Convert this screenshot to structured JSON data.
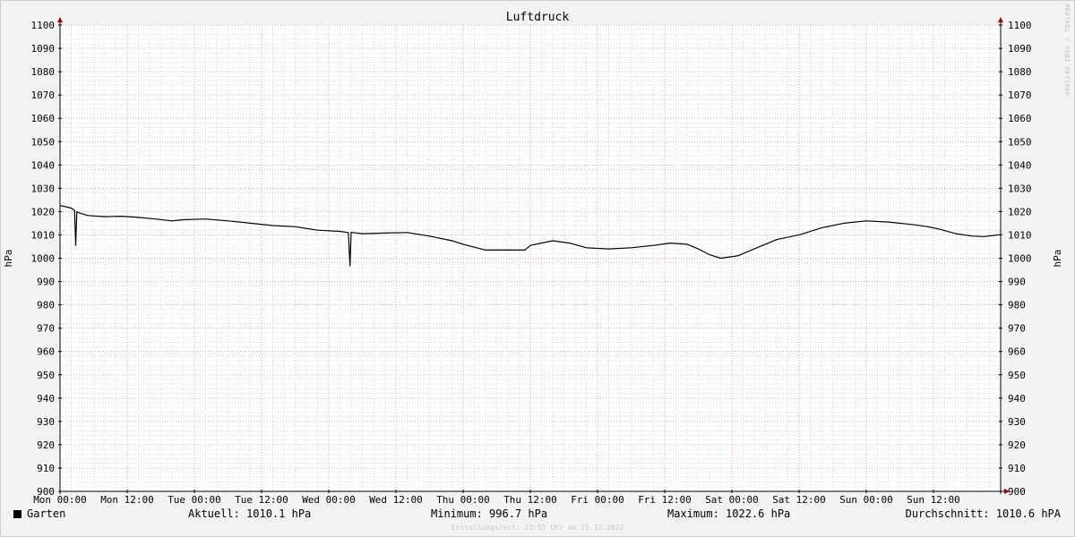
{
  "chart_data": {
    "type": "line",
    "title": "Luftdruck",
    "ylabel": "hPa",
    "ylim": [
      900,
      1100
    ],
    "yticks": [
      900,
      910,
      920,
      930,
      940,
      950,
      960,
      970,
      980,
      990,
      1000,
      1010,
      1020,
      1030,
      1040,
      1050,
      1060,
      1070,
      1080,
      1090,
      1100
    ],
    "xlim": [
      0,
      168
    ],
    "x_unit": "hours since Mon 00:00",
    "xticks": [
      {
        "x": 0,
        "label": "Mon 00:00"
      },
      {
        "x": 12,
        "label": "Mon 12:00"
      },
      {
        "x": 24,
        "label": "Tue 00:00"
      },
      {
        "x": 36,
        "label": "Tue 12:00"
      },
      {
        "x": 48,
        "label": "Wed 00:00"
      },
      {
        "x": 60,
        "label": "Wed 12:00"
      },
      {
        "x": 72,
        "label": "Thu 00:00"
      },
      {
        "x": 84,
        "label": "Thu 12:00"
      },
      {
        "x": 96,
        "label": "Fri 00:00"
      },
      {
        "x": 108,
        "label": "Fri 12:00"
      },
      {
        "x": 120,
        "label": "Sat 00:00"
      },
      {
        "x": 132,
        "label": "Sat 12:00"
      },
      {
        "x": 144,
        "label": "Sun 00:00"
      },
      {
        "x": 156,
        "label": "Sun 12:00"
      }
    ],
    "grid": true,
    "series": [
      {
        "name": "Garten",
        "color": "#000000",
        "x": [
          0,
          2,
          2.6,
          2.8,
          3.0,
          3.3,
          5,
          8,
          11,
          14,
          17,
          20,
          22,
          26,
          30,
          34,
          38,
          42,
          46,
          50,
          51.5,
          51.8,
          52.0,
          52.3,
          54,
          58,
          62,
          66,
          70,
          72,
          76,
          80,
          83,
          84,
          88,
          91,
          94,
          98,
          102,
          106,
          109,
          112,
          114,
          116,
          118,
          121,
          124,
          128,
          132,
          136,
          140,
          144,
          148,
          152,
          155,
          157,
          160,
          163,
          165,
          168
        ],
        "y": [
          1022.6,
          1021.5,
          1020.5,
          1005.5,
          1020.0,
          1019.5,
          1018.3,
          1017.8,
          1018.0,
          1017.5,
          1016.8,
          1016.0,
          1016.5,
          1016.8,
          1016.0,
          1015.0,
          1014.0,
          1013.5,
          1012.0,
          1011.5,
          1011.0,
          996.7,
          1011.2,
          1011.0,
          1010.5,
          1010.8,
          1011.0,
          1009.5,
          1007.5,
          1006.0,
          1003.5,
          1003.5,
          1003.5,
          1005.5,
          1007.5,
          1006.5,
          1004.5,
          1004.0,
          1004.5,
          1005.5,
          1006.5,
          1006.0,
          1004.0,
          1001.5,
          1000.0,
          1001.0,
          1004.0,
          1008.0,
          1010.0,
          1013.0,
          1015.0,
          1016.0,
          1015.5,
          1014.5,
          1013.5,
          1012.5,
          1010.5,
          1009.5,
          1009.3,
          1010.1
        ]
      }
    ]
  },
  "legend": {
    "series_name": "Garten",
    "current": "Aktuell: 1010.1 hPa",
    "minimum": "Minimum: 996.7 hPa",
    "maximum": "Maximum: 1022.6 hPa",
    "average": "Durchschnitt: 1010.6 hPA"
  },
  "footer": {
    "created": "Erstellungszeit: 23:55 Uhr am 25.12.2022",
    "watermark": "RRDTOOL / TOBI OETIKER"
  },
  "colors": {
    "background": "#f3f3f3",
    "plot_background": "#ffffff",
    "major_grid": "#e8a0a0",
    "minor_grid": "#d8d8d8",
    "axis": "#000000",
    "arrow": "#aa0000",
    "line": "#000000"
  }
}
